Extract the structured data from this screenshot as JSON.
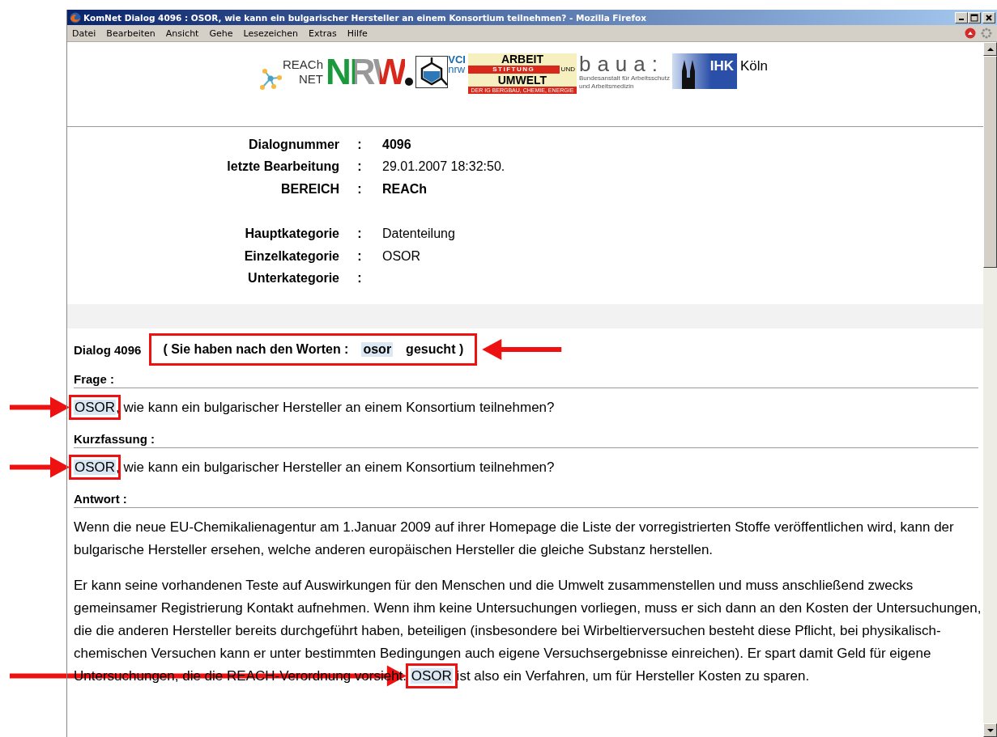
{
  "window": {
    "title": "KomNet Dialog 4096 : OSOR, wie kann ein bulgarischer Hersteller an einem Konsortium teilnehmen? - Mozilla Firefox",
    "menu": [
      "Datei",
      "Bearbeiten",
      "Ansicht",
      "Gehe",
      "Lesezeichen",
      "Extras",
      "Hilfe"
    ]
  },
  "logos": [
    {
      "kind": "reach-net",
      "texts": [
        "REACh",
        "NET"
      ]
    },
    {
      "kind": "nrw",
      "texts": [
        "NRW"
      ]
    },
    {
      "kind": "vci",
      "texts": [
        "VCI",
        "nrw"
      ]
    },
    {
      "kind": "arbeit-umwelt",
      "texts": [
        "ARBEIT",
        "STIFTUNG",
        "UND",
        "UMWELT",
        "DER IG BERGBAU, CHEMIE, ENERGIE"
      ]
    },
    {
      "kind": "baua",
      "texts": [
        "baua:",
        "Bundesanstalt für Arbeitsschutz",
        "und Arbeitsmedizin"
      ]
    },
    {
      "kind": "ihk",
      "texts": [
        "IHK",
        "Köln"
      ]
    }
  ],
  "info_groups": [
    [
      {
        "label": "Dialognummer",
        "separator": ":",
        "value": "4096",
        "bold": true
      },
      {
        "label": "letzte Bearbeitung",
        "separator": ":",
        "value": "29.01.2007 18:32:50.",
        "bold": false
      },
      {
        "label": "BEREICH",
        "separator": ":",
        "value": "REACh",
        "bold": true
      }
    ],
    [
      {
        "label": "Hauptkategorie",
        "separator": ":",
        "value": "Datenteilung",
        "bold": false
      },
      {
        "label": "Einzelkategorie",
        "separator": ":",
        "value": "OSOR",
        "bold": false
      },
      {
        "label": "Unterkategorie",
        "separator": ":"
      }
    ]
  ],
  "dialog": {
    "label": "Dialog 4096",
    "search": {
      "boxed": true,
      "segments": [
        {
          "text": "( Sie haben nach den Worten :",
          "highlighted": false
        },
        {
          "text": "osor",
          "highlighted": true
        },
        {
          "text": "gesucht )",
          "highlighted": false
        }
      ]
    }
  },
  "sections": [
    {
      "heading": "Frage :",
      "paragraphs": [
        [
          {
            "text": "OSOR",
            "highlighted": true,
            "boxed": true
          },
          {
            "text": ", wie kann ein bulgarischer Hersteller an einem Konsortium teilnehmen?",
            "highlighted": false,
            "boxed": false
          }
        ]
      ]
    },
    {
      "heading": "Kurzfassung :",
      "paragraphs": [
        [
          {
            "text": "OSOR",
            "highlighted": true,
            "boxed": true
          },
          {
            "text": ", wie kann ein bulgarischer Hersteller an einem Konsortium teilnehmen?",
            "highlighted": false,
            "boxed": false
          }
        ]
      ]
    },
    {
      "heading": "Antwort :",
      "paragraphs": [
        [
          {
            "text": "Wenn die neue EU-Chemikalienagentur am 1.Januar 2009 auf ihrer Homepage die Liste der vorregistrierten Stoffe veröffentlichen wird, kann der bulgarische Hersteller ersehen, welche anderen europäischen Hersteller die gleiche Substanz herstellen.",
            "highlighted": false,
            "boxed": false
          }
        ],
        [
          {
            "text": "Er kann seine vorhandenen Teste auf Auswirkungen für den Menschen und die Umwelt zusammenstellen und muss anschließend zwecks gemeinsamer Registrierung Kontakt aufnehmen. Wenn ihm keine Untersuchungen vorliegen, muss er sich dann an den Kosten der Untersuchungen, die die anderen Hersteller bereits durchgeführt haben, beteiligen (insbesondere bei Wirbeltierversuchen besteht diese Pflicht, bei physikalisch-chemischen Versuchen kann er unter bestimmten Bedingungen auch eigene Versuchsergebnisse einreichen). Er spart damit Geld für eigene Untersuchungen, die die REACH-Verordnung vorsieht.",
            "highlighted": false,
            "boxed": false
          },
          {
            "text": "OSOR",
            "highlighted": true,
            "boxed": true
          },
          {
            "text": "ist also ein Verfahren, um für Hersteller Kosten zu sparen.",
            "highlighted": false,
            "boxed": false
          }
        ]
      ]
    }
  ]
}
